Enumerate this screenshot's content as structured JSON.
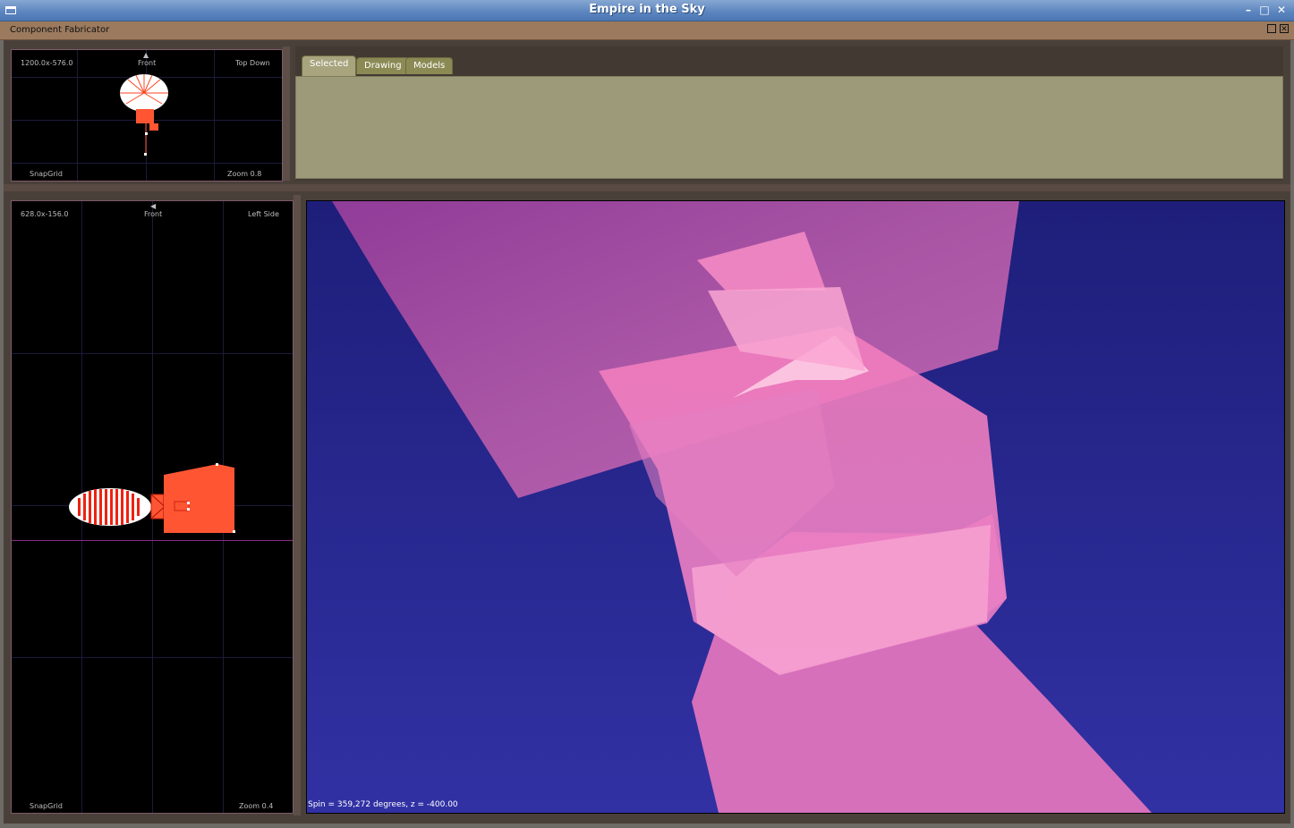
{
  "window": {
    "title": "Empire in the Sky"
  },
  "inner_window": {
    "title": "Component Fabricator"
  },
  "top_view": {
    "coords": "1200.0x-576.0",
    "front_label": "Front",
    "view_name": "Top Down",
    "snap": "SnapGrid",
    "zoom": "Zoom 0.8"
  },
  "side_view": {
    "coords": "628.0x-156.0",
    "front_label": "Front",
    "view_name": "Left Side",
    "snap": "SnapGrid",
    "zoom": "Zoom 0.4"
  },
  "tabs": [
    {
      "label": "Selected",
      "active": true
    },
    {
      "label": "Drawing",
      "active": false
    },
    {
      "label": "Models",
      "active": false
    }
  ],
  "viewport": {
    "status": "Spin = 359,272 degrees, z = -400.00",
    "bg_color": "#2c2c92",
    "shape_color": "#e57dc0"
  },
  "colors": {
    "titlebar": "#5b84bf",
    "inner_bar": "#9b7a5e",
    "panel_bg": "#9c9a78",
    "model_red": "#ff5533"
  }
}
